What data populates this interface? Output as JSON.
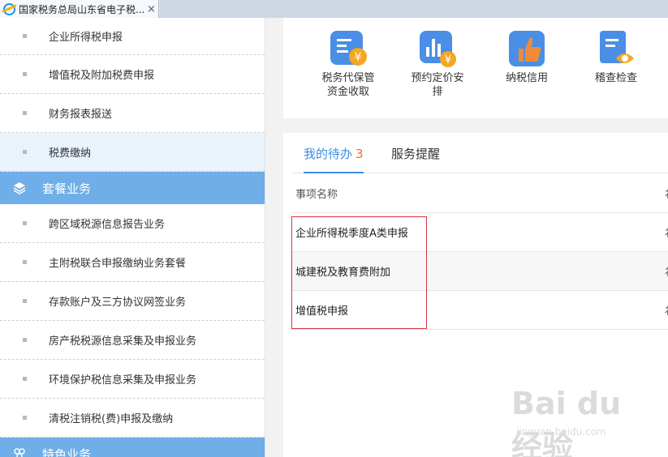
{
  "browser": {
    "tab_title": "国家税务总局山东省电子税...",
    "close_symbol": "×"
  },
  "sidebar": {
    "items_top": [
      {
        "label": "企业所得税申报"
      },
      {
        "label": "增值税及附加税费申报"
      },
      {
        "label": "财务报表报送"
      },
      {
        "label": "税费缴纳",
        "active": true
      }
    ],
    "group_package": {
      "label": "套餐业务",
      "icon": "layers-icon"
    },
    "items_package": [
      {
        "label": "跨区域税源信息报告业务"
      },
      {
        "label": "主附税联合申报缴纳业务套餐"
      },
      {
        "label": "存款账户及三方协议网签业务"
      },
      {
        "label": "房产税税源信息采集及申报业务"
      },
      {
        "label": "环境保护税信息采集及申报业务"
      },
      {
        "label": "清税注销税(费)申报及缴纳"
      }
    ],
    "group_special": {
      "label": "特色业务",
      "icon": "special-icon"
    }
  },
  "quick_actions": [
    {
      "label": "税务代保管资金收取",
      "icon": "payment-document-icon",
      "color": "#4a8ee6"
    },
    {
      "label": "预约定价安排",
      "icon": "chart-yen-icon",
      "color": "#4a8ee6"
    },
    {
      "label": "纳税信用",
      "icon": "thumbs-up-icon",
      "color": "#f08a3a"
    },
    {
      "label": "稽查检查",
      "icon": "inspection-eye-icon",
      "color": "#4a8ee6"
    }
  ],
  "todo": {
    "tabs": [
      {
        "label": "我的待办",
        "count": "3",
        "active": true
      },
      {
        "label": "服务提醒"
      }
    ],
    "column_header": "事项名称",
    "column_header2": "ﾈ",
    "rows": [
      {
        "name": "企业所得税季度A类申报"
      },
      {
        "name": "城建税及教育费附加"
      },
      {
        "name": "增值税申报"
      }
    ]
  },
  "watermark": {
    "main": "Bai du 经验",
    "sub": "jingyan.baidu.com"
  },
  "colors": {
    "accent": "#6faee8",
    "tab_active": "#3c8ee0",
    "count": "#f26b3a",
    "highlight": "#d9363e"
  }
}
